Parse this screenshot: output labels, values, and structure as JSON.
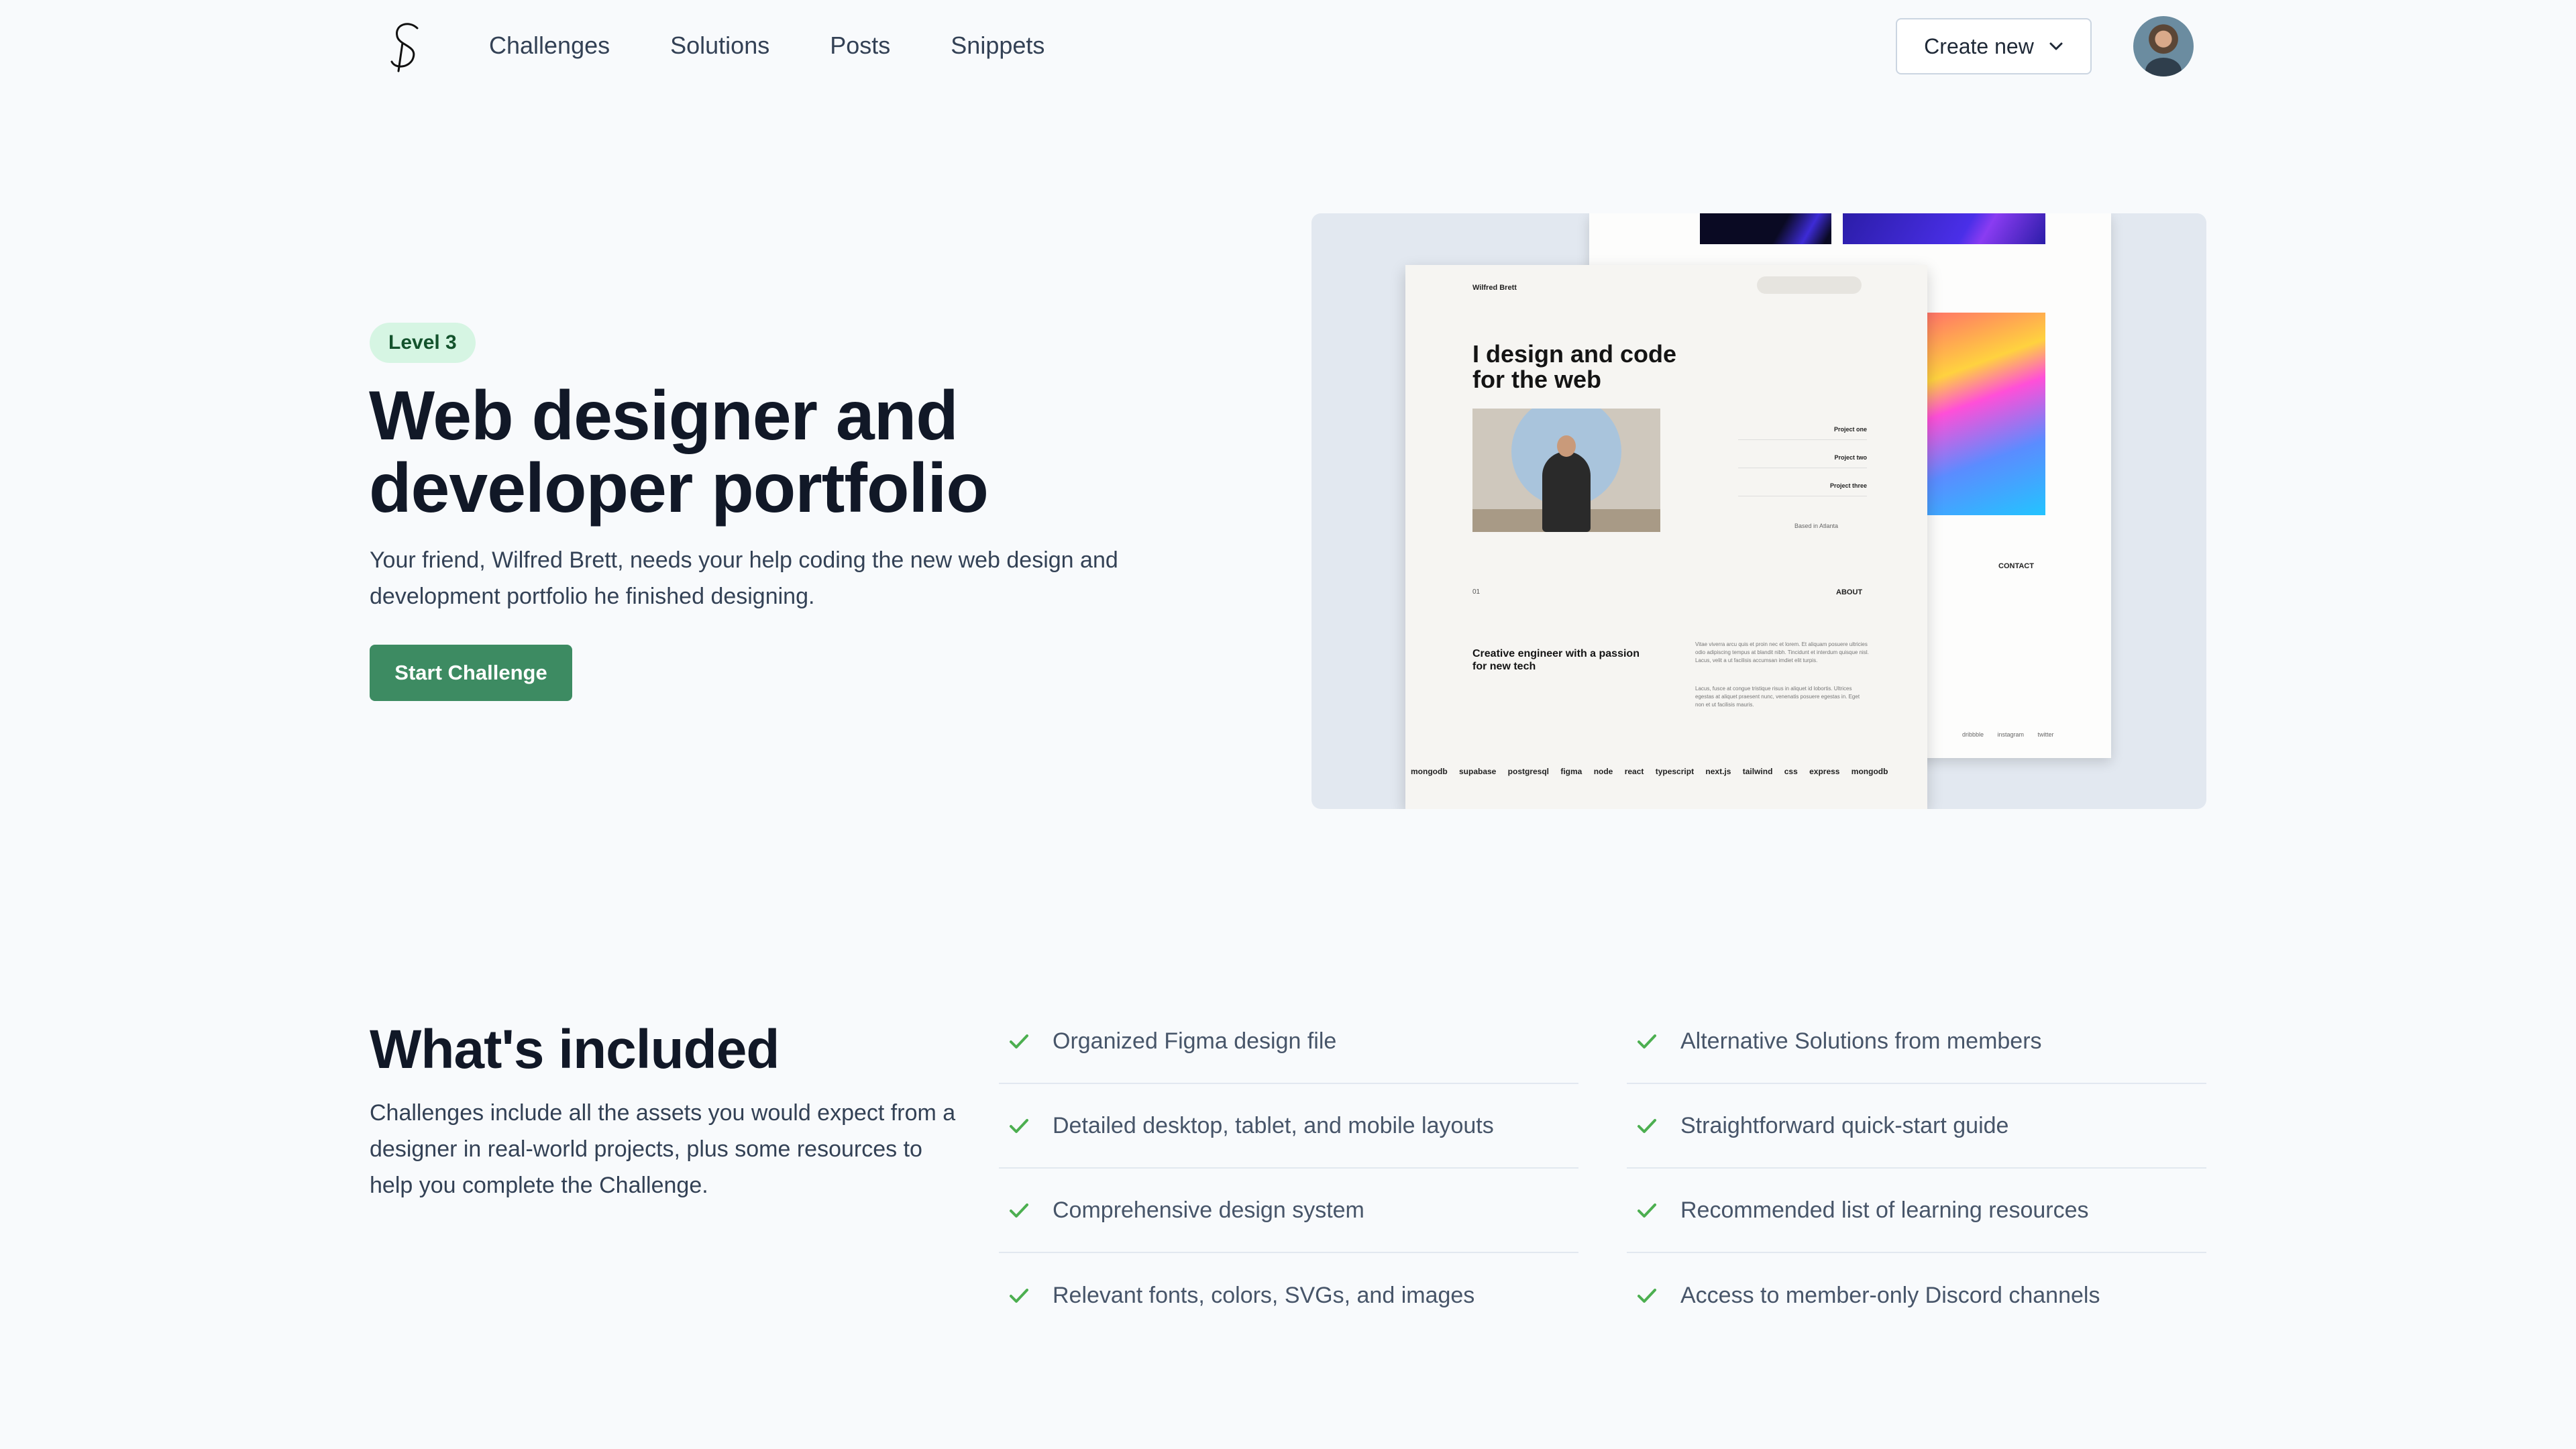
{
  "nav": {
    "items": [
      "Challenges",
      "Solutions",
      "Posts",
      "Snippets"
    ],
    "create_label": "Create new"
  },
  "hero": {
    "badge": "Level 3",
    "title": "Web designer and developer portfolio",
    "description": "Your friend, Wilfred Brett, needs your help coding the new web design and development portfolio he finished designing.",
    "cta": "Start Challenge"
  },
  "preview": {
    "name": "Wilfred Brett",
    "headline": "I design and code for the web",
    "projects": [
      "Project one",
      "Project two",
      "Project three"
    ],
    "based": "Based in Atlanta",
    "about": "ABOUT",
    "contact": "CONTACT",
    "subheading": "Creative engineer with a passion for new tech",
    "tech_list": "mongodb supabase postgresql figma node react typescript next.js tailwind css express mongodb",
    "footer_links": "dribbble instagram twitter"
  },
  "included": {
    "title": "What's included",
    "description": "Challenges include all the assets you would expect from a designer in real-world projects, plus some resources to help you complete the Challenge.",
    "col1": [
      "Organized Figma design file",
      "Detailed desktop, tablet, and mobile layouts",
      "Comprehensive design system",
      "Relevant fonts, colors, SVGs, and images"
    ],
    "col2": [
      "Alternative Solutions from members",
      "Straightforward quick-start guide",
      "Recommended list of learning resources",
      "Access to member-only Discord channels"
    ]
  },
  "colors": {
    "accent": "#3d8b62",
    "badge_bg": "#d6f5e3",
    "check": "#4caf50"
  }
}
